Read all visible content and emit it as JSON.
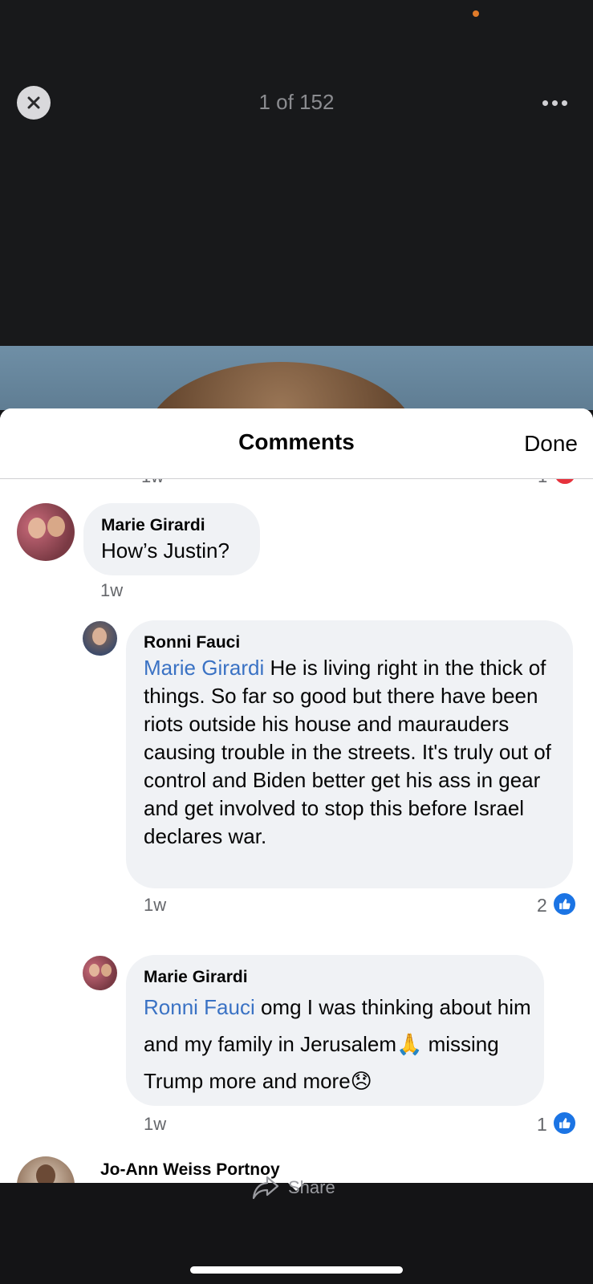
{
  "viewer": {
    "counter": "1 of 152",
    "share_label": "Share"
  },
  "sheet": {
    "title": "Comments",
    "done_label": "Done"
  },
  "cut_off_row": {
    "time": "1w",
    "reaction_count": "1",
    "reaction_icon": "heart-icon"
  },
  "comments": [
    {
      "author": "Marie Girardi",
      "text": "How’s Justin?",
      "time": "1w"
    },
    {
      "author": "Ronni Fauci",
      "mention": "Marie Girardi",
      "text": " He is living right in the thick of things. So far so good but there have been riots outside his house and maurauders causing trouble in the streets. It's truly out of control and Biden better get his ass in gear and get involved to stop this before Israel declares war.",
      "time": "1w",
      "reaction_count": "2",
      "reaction_icon": "like-icon"
    },
    {
      "author": "Marie Girardi",
      "mention": "Ronni Fauci",
      "text": " omg I was thinking about him and my family in Jerusalem🙏 missing Trump more and more😞",
      "time": "1w",
      "reaction_count": "1",
      "reaction_icon": "like-icon"
    },
    {
      "author": "Jo-Ann Weiss Portnoy"
    }
  ],
  "colors": {
    "mention": "#3a72c4",
    "like_badge": "#1b74e4",
    "heart_badge": "#e6323c",
    "bubble": "#f0f2f5"
  }
}
